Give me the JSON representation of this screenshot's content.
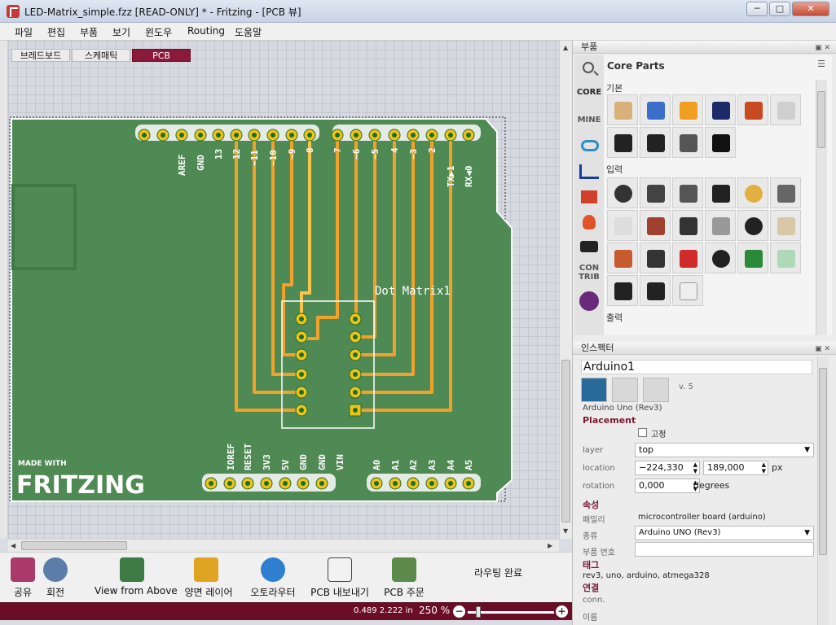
{
  "window": {
    "title": "LED-Matrix_simple.fzz [READ-ONLY] * - Fritzing - [PCB 뷰]",
    "minimize": "─",
    "maximize": "□",
    "close": "✕"
  },
  "menu": [
    "파일",
    "편집",
    "부품",
    "보기",
    "윈도우",
    "Routing",
    "도움말"
  ],
  "view_tabs": [
    {
      "label": "브레드보드",
      "active": false
    },
    {
      "label": "스케매틱",
      "active": false
    },
    {
      "label": "PCB",
      "active": true
    }
  ],
  "board": {
    "top_header_labels": [
      "AREF",
      "GND",
      "13",
      "12",
      "~11",
      "~10",
      "~9",
      "8",
      "7",
      "~6",
      "~5",
      "4",
      "~3",
      "2",
      "TX▶1",
      "RX◀0"
    ],
    "bottom_header_labels": [
      "IOREF",
      "RESET",
      "3V3",
      "5V",
      "GND",
      "GND",
      "VIN",
      "A0",
      "A1",
      "A2",
      "A3",
      "A4",
      "A5"
    ],
    "part_label": "Dot Matrix1",
    "logo_small": "MADE WITH",
    "logo_big": "FRITZING",
    "colors": {
      "board": "#4f8a54",
      "trace": "#f2a12a",
      "trace_light": "#f7c34a",
      "pad_ring": "#f1c40f",
      "pad_hole": "#1f6b34"
    }
  },
  "toolbar": [
    {
      "label": "공유",
      "icon": "gift-icon"
    },
    {
      "label": "회전",
      "icon": "rotate-icon"
    },
    {
      "label": "View from Above",
      "icon": "view-from-above-icon"
    },
    {
      "label": "양면 레이어",
      "icon": "layers-icon"
    },
    {
      "label": "오토라우터",
      "icon": "autorouter-icon"
    },
    {
      "label": "PCB 내보내기",
      "icon": "export-pcb-icon"
    },
    {
      "label": "PCB 주문",
      "icon": "order-pcb-icon"
    }
  ],
  "routing_status": "라우팅 완료",
  "status": {
    "coords": "0.489 2.222 in",
    "zoom": "250 %",
    "zoom_out": "−",
    "zoom_in": "+",
    "zoom_fraction": 0.1
  },
  "parts_panel": {
    "title": "부품",
    "bin_title": "Core Parts",
    "bin_tabs": [
      "CORE",
      "MINE",
      "CON TRIB"
    ],
    "sections": [
      "기본",
      "입력",
      "출력"
    ]
  },
  "inspector": {
    "title": "인스펙터",
    "part_title": "Arduino1",
    "version": "v. 5",
    "part_name": "Arduino Uno (Rev3)",
    "placement_section": "Placement",
    "lock_label": "고정",
    "layer_label": "layer",
    "layer_value": "top",
    "location_label": "location",
    "location_x": "−224,330",
    "location_y": "189,000",
    "location_unit": "px",
    "rotation_label": "rotation",
    "rotation_value": "0,000",
    "rotation_unit": "degrees",
    "props_section": "속성",
    "family_label": "패밀리",
    "family_value": "microcontroller board (arduino)",
    "type_label": "종류",
    "type_value": "Arduino UNO (Rev3)",
    "part_number_label": "부품 번호",
    "tags_section": "태그",
    "tags_value": "rev3, uno, arduino, atmega328",
    "connections_section": "연결",
    "conn_label": "conn.",
    "name_label": "이름"
  }
}
